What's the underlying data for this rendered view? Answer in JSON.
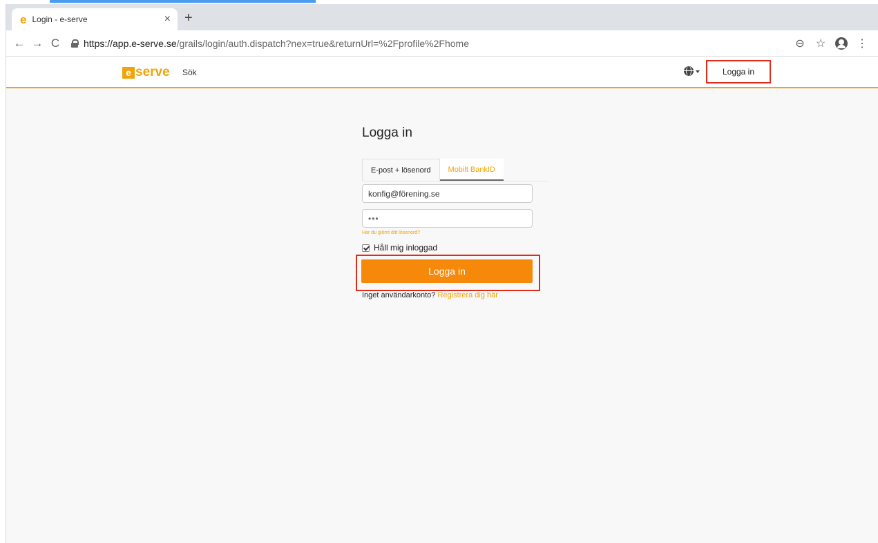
{
  "browser": {
    "tab_title": "Login - e-serve",
    "tab_close": "×",
    "new_tab": "+",
    "url_host": "https://app.e-serve.se",
    "url_path": "/grails/login/auth.dispatch?nex=true&returnUrl=%2Fprofile%2Fhome",
    "icons": {
      "back": "←",
      "forward": "→",
      "reload": "C",
      "zoom": "⊖",
      "bookmark": "☆",
      "menu": "⋮"
    }
  },
  "header": {
    "logo_box": "e",
    "logo_text": "serve",
    "nav_search": "Sök",
    "login_label": "Logga in"
  },
  "login": {
    "title": "Logga in",
    "tabs": [
      {
        "label": "E-post + lösenord"
      },
      {
        "label": "Mobilt BankID"
      }
    ],
    "email_value": "konfig@förening.se",
    "password_value": "•••",
    "forgot_label": "Har du glömt ditt lösenord?",
    "remember_label": "Håll mig inloggad",
    "remember_checked": true,
    "submit_label": "Logga in",
    "register_prefix": "Inget användarkonto?",
    "register_link": "Registrera dig här"
  },
  "colors": {
    "accent": "#f0a30a",
    "button": "#f7890a",
    "highlight": "#e02b1a"
  }
}
